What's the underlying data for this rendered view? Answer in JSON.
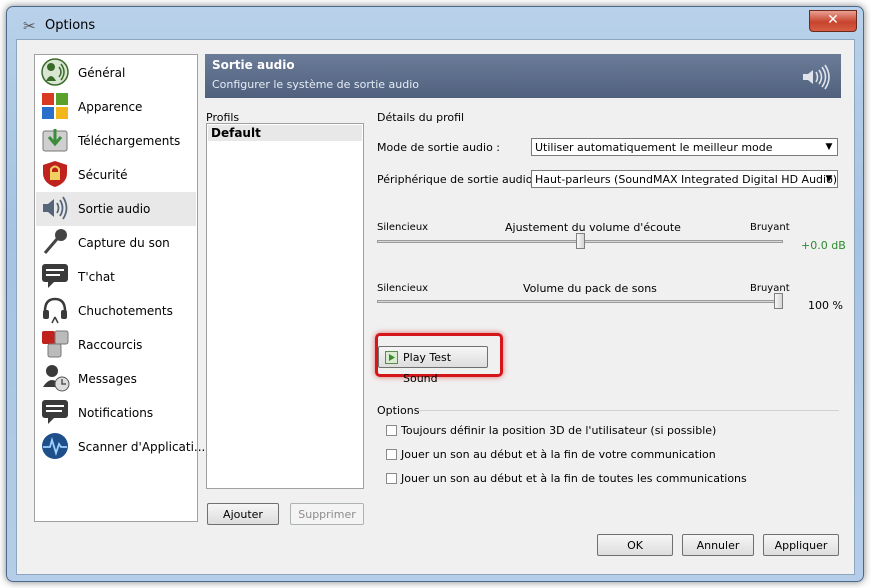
{
  "window": {
    "title": "Options",
    "close_glyph": "✕"
  },
  "sidebar": {
    "items": [
      {
        "label": "Général",
        "icon": "speaker-person-icon",
        "color": "#3a6a2a"
      },
      {
        "label": "Apparence",
        "icon": "windows-flag-icon",
        "color": "#d83b21"
      },
      {
        "label": "Téléchargements",
        "icon": "download-arrow-icon",
        "color": "#3b8c3b"
      },
      {
        "label": "Sécurité",
        "icon": "shield-lock-icon",
        "color": "#c0231e"
      },
      {
        "label": "Sortie audio",
        "icon": "speaker-waves-icon",
        "color": "#55657a",
        "active": true
      },
      {
        "label": "Capture du son",
        "icon": "microphone-icon",
        "color": "#444444"
      },
      {
        "label": "T'chat",
        "icon": "chat-bubble-icon",
        "color": "#3a3a3a"
      },
      {
        "label": "Chuchotements",
        "icon": "headset-icon",
        "color": "#3a3a3a"
      },
      {
        "label": "Raccourcis",
        "icon": "shortcut-keys-icon",
        "color": "#c0231e"
      },
      {
        "label": "Messages",
        "icon": "messages-icon",
        "color": "#3a3a3a"
      },
      {
        "label": "Notifications",
        "icon": "notification-icon",
        "color": "#3a3a3a"
      },
      {
        "label": "Scanner d'Applicati...",
        "icon": "globe-scanner-icon",
        "color": "#1f4f8a"
      }
    ]
  },
  "header": {
    "title": "Sortie audio",
    "subtitle": "Configurer le système de sortie audio",
    "icon": "speaker-waves-icon"
  },
  "profiles": {
    "label": "Profils",
    "items": [
      "Default"
    ],
    "add_button": "Ajouter",
    "remove_button": "Supprimer"
  },
  "details": {
    "label": "Détails du profil",
    "mode_label": "Mode de sortie audio :",
    "mode_value": "Utiliser automatiquement le meilleur mode",
    "device_label": "Périphérique de sortie audio :",
    "device_value": "Haut-parleurs (SoundMAX Integrated Digital HD Audio)",
    "volume": {
      "min_label": "Silencieux",
      "title": "Ajustement du volume d'écoute",
      "max_label": "Bruyant",
      "value_text": "+0.0 dB",
      "value_color": "#2e8b2e",
      "level": 0.5
    },
    "soundpack": {
      "min_label": "Silencieux",
      "title": "Volume du pack de sons",
      "max_label": "Bruyant",
      "value_text": "100 %",
      "level": 1.0
    },
    "test_button": "Play Test Sound"
  },
  "options": {
    "label": "Options",
    "checks": [
      {
        "label": "Toujours définir la position 3D de l'utilisateur (si possible)",
        "checked": false
      },
      {
        "label": "Jouer un son au début et à la fin de votre communication",
        "checked": false
      },
      {
        "label": "Jouer un son au début et à la fin de toutes les communications",
        "checked": false
      }
    ]
  },
  "footer": {
    "ok": "OK",
    "cancel": "Annuler",
    "apply": "Appliquer"
  }
}
